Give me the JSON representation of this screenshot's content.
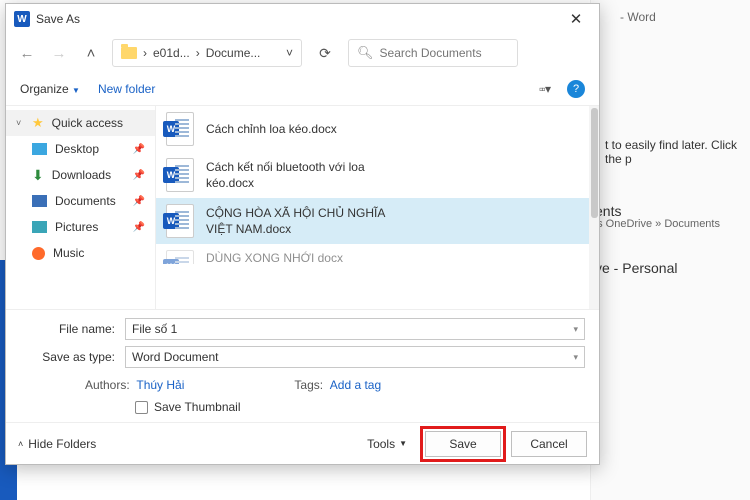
{
  "word_app": {
    "title_fragment": "- Word",
    "hint": "t to easily find later. Click the p",
    "ents": "ents",
    "onedrive": "'s OneDrive » Documents",
    "personal": "ve - Personal",
    "close": "Close"
  },
  "dialog": {
    "title": "Save As",
    "nav": {
      "crumb1": "e01d...",
      "crumb2": "Docume...",
      "search_placeholder": "Search Documents"
    },
    "toolbar": {
      "organize": "Organize",
      "newfolder": "New folder"
    },
    "sidebar": {
      "quick": "Quick access",
      "items": [
        {
          "label": "Desktop"
        },
        {
          "label": "Downloads"
        },
        {
          "label": "Documents"
        },
        {
          "label": "Pictures"
        },
        {
          "label": "Music"
        }
      ]
    },
    "files": [
      {
        "name": "Cách chỉnh loa kéo.docx"
      },
      {
        "name": "Cách kết nối bluetooth với loa kéo.docx"
      },
      {
        "name": "CỘNG HÒA XÃ HỘI CHỦ NGHĨA VIỆT NAM.docx"
      },
      {
        "name": "DÙNG XONG NHỚI docx"
      }
    ],
    "filename_label": "File name:",
    "filename_value": "File số 1",
    "savetype_label": "Save as type:",
    "savetype_value": "Word Document",
    "authors_label": "Authors:",
    "authors_value": "Thúy Hải",
    "tags_label": "Tags:",
    "tags_value": "Add a tag",
    "thumb": "Save Thumbnail",
    "hide": "Hide Folders",
    "tools": "Tools",
    "save": "Save",
    "cancel": "Cancel"
  }
}
